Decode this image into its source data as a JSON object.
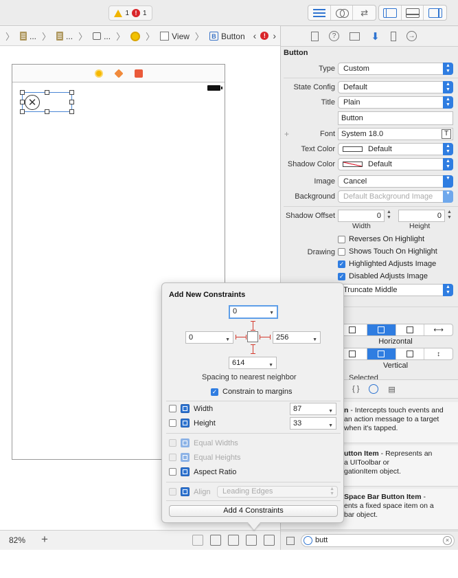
{
  "toolbar": {
    "warning_count": "1",
    "error_count": "1"
  },
  "jumpbar": {
    "crumb1": "...",
    "crumb2": "...",
    "crumb3": "...",
    "view": "View",
    "button": "Button"
  },
  "zoom": "82%",
  "inspector": {
    "section_title": "Button",
    "type_label": "Type",
    "type_value": "Custom",
    "state_label": "State Config",
    "state_value": "Default",
    "title_label": "Title",
    "title_value": "Plain",
    "title_text": "Button",
    "font_label": "Font",
    "font_value": "System 18.0",
    "text_color_label": "Text Color",
    "text_color_value": "Default",
    "shadow_color_label": "Shadow Color",
    "shadow_color_value": "Default",
    "image_label": "Image",
    "image_value": "Cancel",
    "background_label": "Background",
    "background_placeholder": "Default Background Image",
    "shadow_offset_label": "Shadow Offset",
    "shadow_w": "0",
    "shadow_h": "0",
    "width_label": "Width",
    "height_label": "Height",
    "drawing_label": "Drawing",
    "reverses": "Reverses On Highlight",
    "shows_touch": "Shows Touch On Highlight",
    "highlighted_adjusts": "Highlighted Adjusts Image",
    "disabled_adjusts": "Disabled Adjusts Image",
    "line_break": "Truncate Middle",
    "horizontal": "Horizontal",
    "vertical": "Vertical",
    "selected": "Selected"
  },
  "library": {
    "item1_title": "n",
    "item1_desc": " - Intercepts touch events and",
    "item1_line2": "an action message to a target",
    "item1_line3": "when it's tapped.",
    "item2_title": "utton Item",
    "item2_desc": " - Represents an",
    "item2_line2": "a UIToolbar or",
    "item2_line3": "gationItem object.",
    "item3_title": "Space Bar Button Item",
    "item3_desc": " -",
    "item3_line2": "ents a fixed space item on a",
    "item3_line3": "bar object.",
    "filter": "butt"
  },
  "popover": {
    "title": "Add New Constraints",
    "top_value": "0",
    "left_value": "0",
    "right_value": "256",
    "bottom_value": "614",
    "spacing_label": "Spacing to nearest neighbor",
    "constrain_margins": "Constrain to margins",
    "width_label": "Width",
    "width_value": "87",
    "height_label": "Height",
    "height_value": "33",
    "equal_widths": "Equal Widths",
    "equal_heights": "Equal Heights",
    "aspect_ratio": "Aspect Ratio",
    "align_label": "Align",
    "align_value": "Leading Edges",
    "add_button": "Add 4 Constraints"
  }
}
